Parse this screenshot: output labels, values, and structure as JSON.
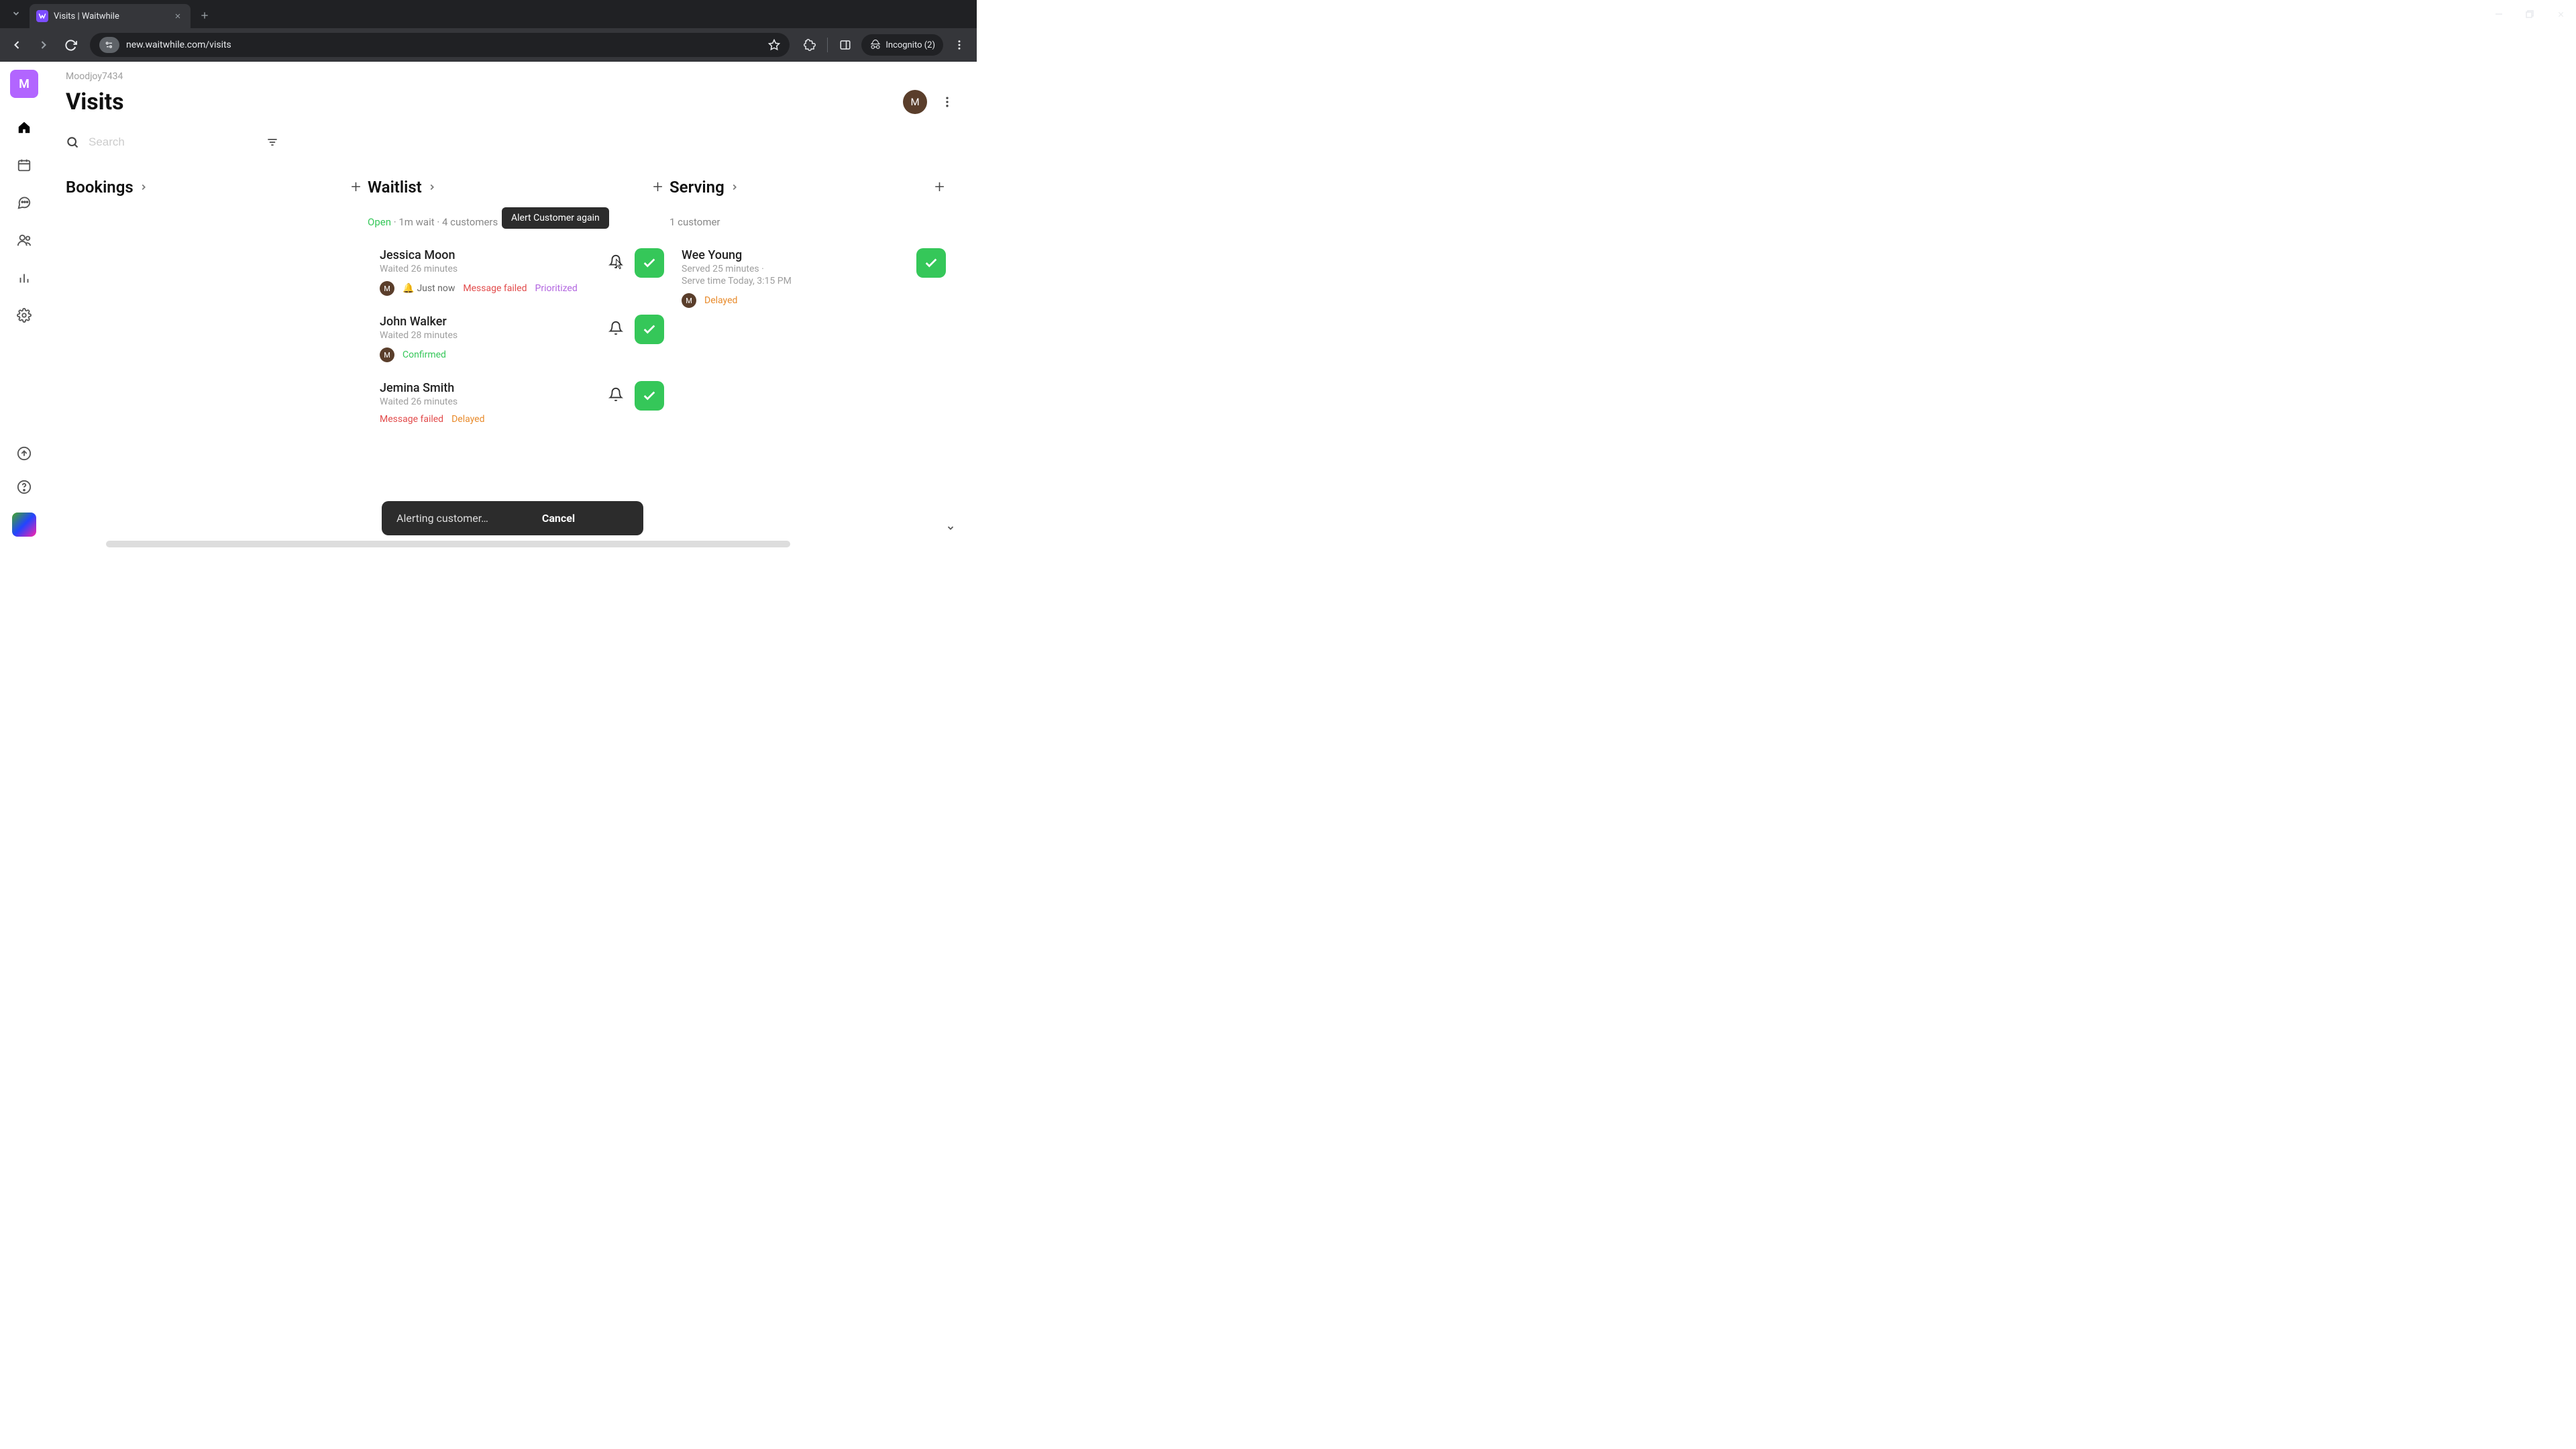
{
  "browser": {
    "tab_title": "Visits | Waitwhile",
    "url": "new.waitwhile.com/visits",
    "incognito_label": "Incognito (2)"
  },
  "workspace": {
    "logo_letter": "M",
    "name": "Moodjoy7434"
  },
  "page": {
    "title": "Visits",
    "avatar_letter": "M",
    "search_placeholder": "Search"
  },
  "columns": {
    "bookings": {
      "title": "Bookings"
    },
    "waitlist": {
      "title": "Waitlist",
      "status_open": "Open",
      "status_rest": " · 1m wait · 4 customers",
      "tooltip": "Alert Customer again",
      "items": [
        {
          "name": "Jessica Moon",
          "sub": "Waited 26 minutes",
          "avatar": "M",
          "warn_text": "Just now",
          "failed": "Message failed",
          "prioritized": "Prioritized",
          "bell_active": true
        },
        {
          "name": "John Walker",
          "sub": "Waited 28 minutes",
          "avatar": "M",
          "confirmed": "Confirmed"
        },
        {
          "name": "Jemina Smith",
          "sub": "Waited 26 minutes",
          "failed": "Message failed",
          "delayed": "Delayed"
        }
      ]
    },
    "serving": {
      "title": "Serving",
      "status": "1 customer",
      "items": [
        {
          "name": "Wee Young",
          "sub1": "Served 25 minutes ·",
          "sub2": "Serve time Today, 3:15 PM",
          "avatar": "M",
          "delayed": "Delayed"
        }
      ]
    }
  },
  "toast": {
    "message": "Alerting customer…",
    "cancel": "Cancel"
  }
}
